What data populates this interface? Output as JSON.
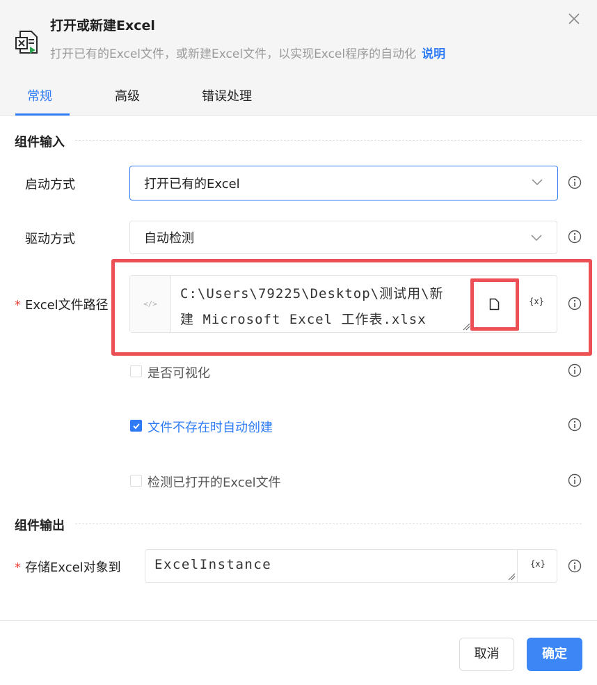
{
  "header": {
    "title": "打开或新建Excel",
    "subtitle": "打开已有的Excel文件，或新建Excel文件，以实现Excel程序的自动化",
    "help_link": "说明",
    "icon": "excel-file-icon"
  },
  "tabs": [
    {
      "label": "常规",
      "active": true
    },
    {
      "label": "高级",
      "active": false
    },
    {
      "label": "错误处理",
      "active": false
    }
  ],
  "section_input": {
    "title": "组件输入"
  },
  "launch_mode": {
    "label": "启动方式",
    "value": "打开已有的Excel"
  },
  "driver_mode": {
    "label": "驱动方式",
    "value": "自动检测"
  },
  "file_path": {
    "required_mark": "*",
    "label": "Excel文件路径",
    "code_toggle": "</>",
    "value_line1": "C:\\Users\\79225\\Desktop\\测试用\\新",
    "value_line2": "建 Microsoft Excel 工作表.xlsx",
    "var_button": "{x}"
  },
  "checkboxes": [
    {
      "label": "是否可视化",
      "checked": false
    },
    {
      "label": "文件不存在时自动创建",
      "checked": true
    },
    {
      "label": "检测已打开的Excel文件",
      "checked": false
    }
  ],
  "section_output": {
    "title": "组件输出"
  },
  "output_var": {
    "required_mark": "*",
    "label": "存储Excel对象到",
    "value": "ExcelInstance",
    "var_button": "{x}"
  },
  "footer": {
    "cancel": "取消",
    "confirm": "确定"
  },
  "colors": {
    "accent": "#2f7bf5",
    "highlight": "#ec5054",
    "required": "#e5453a"
  }
}
